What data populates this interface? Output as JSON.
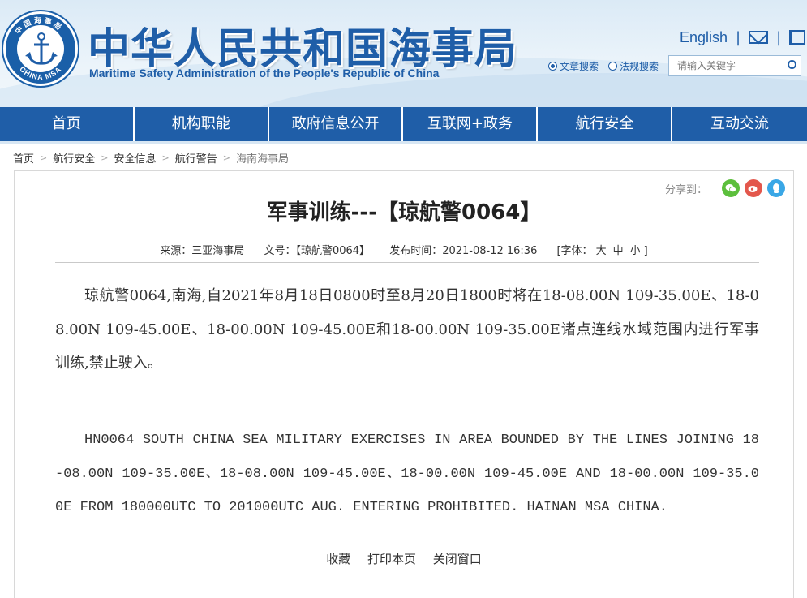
{
  "header": {
    "title_cn": "中华人民共和国海事局",
    "title_en": "Maritime Safety Administration of the People's Republic of China",
    "logo_text_top": "中国海事局",
    "logo_text_bottom": "CHINA MSA",
    "english_link": "English",
    "separator": "|",
    "search": {
      "option_article": "文章搜索",
      "option_regulation": "法规搜索",
      "selected": "文章搜索",
      "placeholder": "请输入关键字"
    }
  },
  "nav": {
    "items": [
      "首页",
      "机构职能",
      "政府信息公开",
      "互联网+政务",
      "航行安全",
      "互动交流"
    ]
  },
  "breadcrumb": {
    "items": [
      "首页",
      "航行安全",
      "安全信息",
      "航行警告",
      "海南海事局"
    ]
  },
  "share": {
    "label": "分享到：",
    "icons": [
      "wechat-icon",
      "weibo-icon",
      "qq-icon"
    ]
  },
  "article": {
    "title": "军事训练---【琼航警0064】",
    "source_label": "来源：三亚海事局",
    "number_label": "文号：【琼航警0064】",
    "date_label": "发布时间：2021-08-12 16:36",
    "font_size_label": "[字体：",
    "font_large": "大",
    "font_medium": "中",
    "font_small": "小",
    "font_close": "]",
    "para_cn": "琼航警0064,南海,自2021年8月18日0800时至8月20日1800时将在18-08.00N 109-35.00E、18-08.00N 109-45.00E、18-00.00N 109-45.00E和18-00.00N 109-35.00E诸点连线水域范围内进行军事训练,禁止驶入。",
    "para_en": "HN0064 SOUTH CHINA SEA MILITARY EXERCISES IN AREA BOUNDED BY THE LINES JOINING 18-08.00N 109-35.00E、18-08.00N 109-45.00E、18-00.00N 109-45.00E AND 18-00.00N 109-35.00E FROM 180000UTC TO 201000UTC AUG. ENTERING PROHIBITED. HAINAN MSA CHINA."
  },
  "actions": {
    "favorite": "收藏",
    "print": "打印本页",
    "close": "关闭窗口"
  },
  "colors": {
    "brand_blue": "#1f5ea8",
    "nav_bg": "#1f5ea8"
  }
}
